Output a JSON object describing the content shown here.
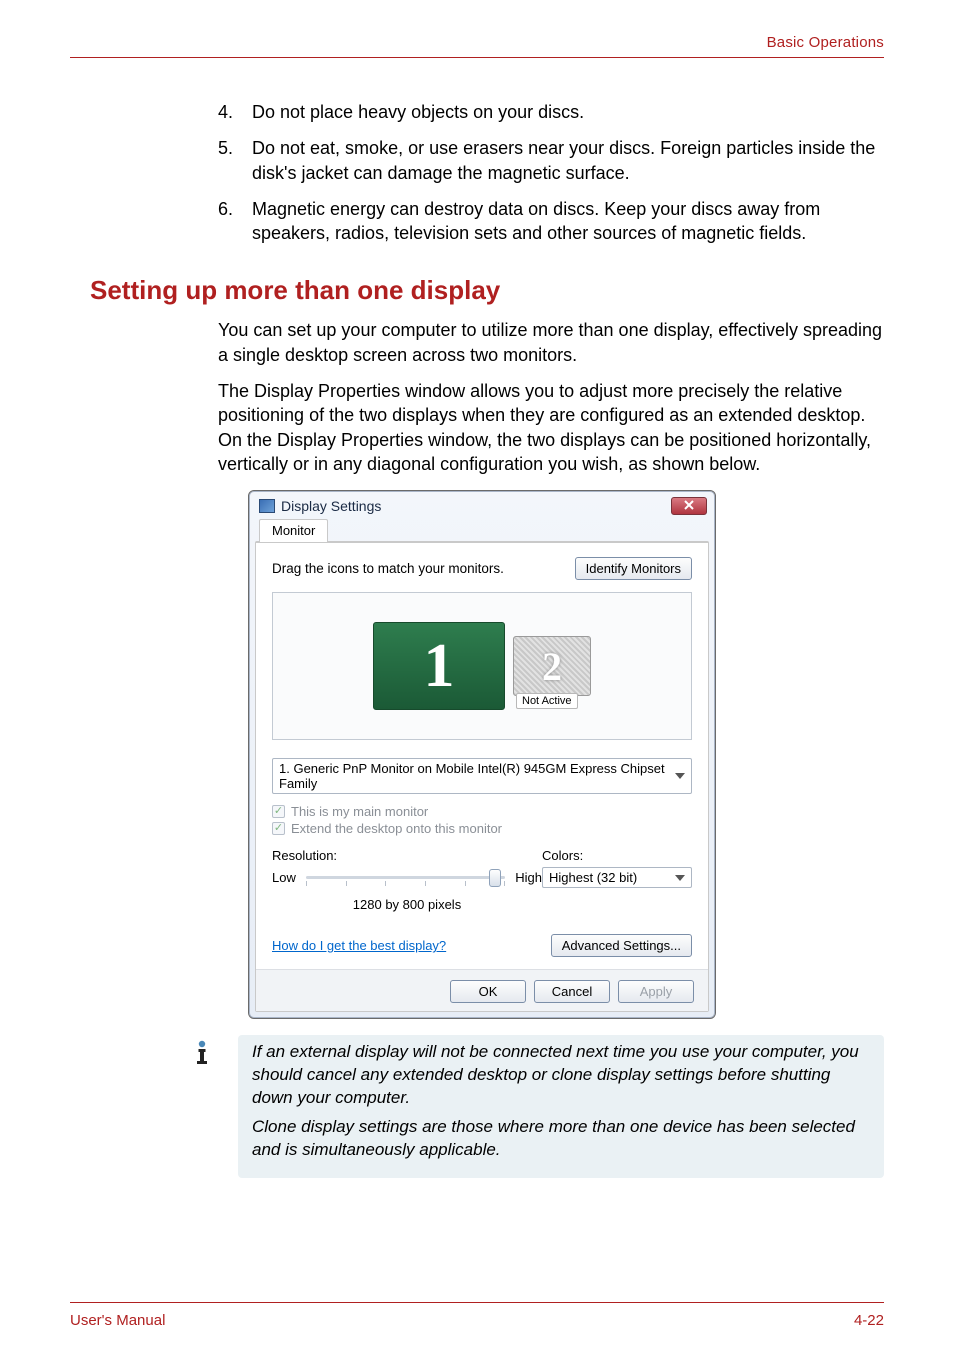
{
  "header": {
    "section": "Basic Operations"
  },
  "list": {
    "items": [
      {
        "num": "4.",
        "text": "Do not place heavy objects on your discs."
      },
      {
        "num": "5.",
        "text": "Do not eat, smoke, or use erasers near your discs. Foreign particles inside the disk's jacket can damage the magnetic surface."
      },
      {
        "num": "6.",
        "text": "Magnetic energy can destroy data on discs. Keep your discs away from speakers, radios, television sets and other sources of magnetic fields."
      }
    ]
  },
  "heading": "Setting up more than one display",
  "paras": [
    "You can set up your computer to utilize more than one display, effectively spreading a single desktop screen across two monitors.",
    "The Display Properties window allows you to adjust more precisely the relative positioning of the two displays when they are configured as an extended desktop. On the Display Properties window, the two displays can be positioned horizontally, vertically or in any diagonal configuration you wish, as shown below."
  ],
  "dialog": {
    "title": "Display Settings",
    "tab": "Monitor",
    "drag_text": "Drag the icons to match your monitors.",
    "identify": "Identify Monitors",
    "monitor1": "1",
    "monitor2": "2",
    "not_active": "Not Active",
    "combo": "1. Generic PnP Monitor on Mobile Intel(R) 945GM Express Chipset Family",
    "chk1": "This is my main monitor",
    "chk2": "Extend the desktop onto this monitor",
    "resolution_label": "Resolution:",
    "colors_label": "Colors:",
    "low": "Low",
    "high": "High",
    "res_value": "1280 by 800 pixels",
    "color_value": "Highest (32 bit)",
    "link": "How do I get the best display?",
    "advanced": "Advanced Settings...",
    "ok": "OK",
    "cancel": "Cancel",
    "apply": "Apply"
  },
  "note": {
    "p1": "If an external display will not be connected next time you use your computer, you should cancel any extended desktop or clone display settings before shutting down your computer.",
    "p2": "Clone display settings are those where more than one device has been selected and is simultaneously applicable."
  },
  "footer": {
    "left": "User's Manual",
    "right": "4-22"
  }
}
